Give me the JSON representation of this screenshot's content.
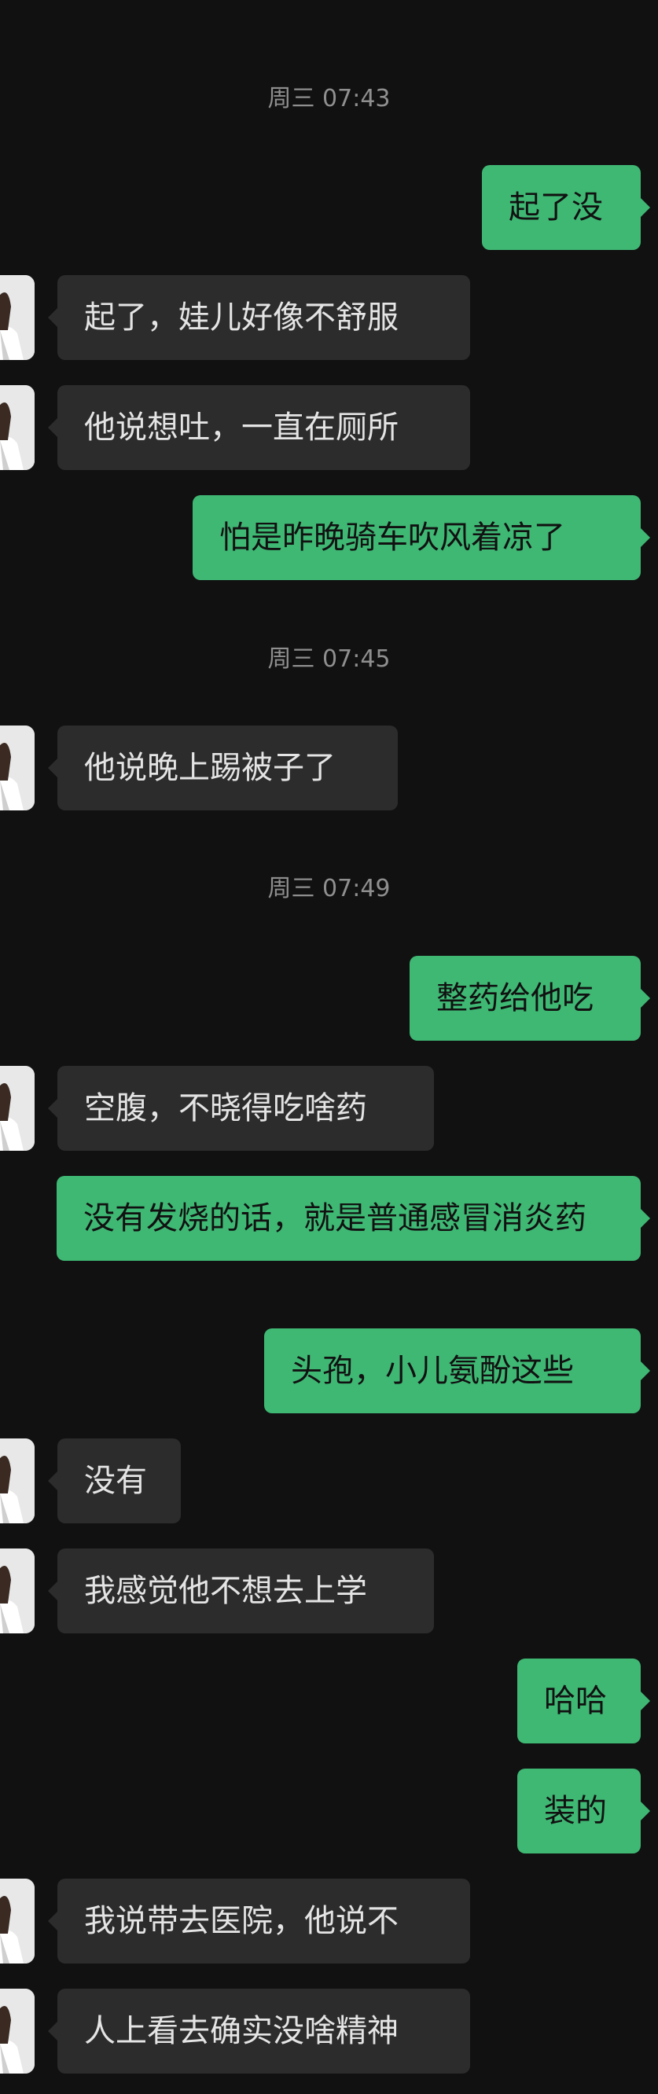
{
  "colors": {
    "background": "#111111",
    "sent_bubble": "#3fb874",
    "received_bubble": "#2c2c2c",
    "timestamp": "#8f8f8f"
  },
  "timestamps": [
    "周三 07:43",
    "周三 07:45",
    "周三 07:49"
  ],
  "messages": [
    {
      "side": "sent",
      "text": "起了没"
    },
    {
      "side": "received",
      "text": "起了，娃儿好像不舒服"
    },
    {
      "side": "received",
      "text": "他说想吐，一直在厕所"
    },
    {
      "side": "sent",
      "text": "怕是昨晚骑车吹风着凉了"
    },
    {
      "side": "received",
      "text": "他说晚上踢被子了"
    },
    {
      "side": "sent",
      "text": "整药给他吃"
    },
    {
      "side": "received",
      "text": "空腹，不晓得吃啥药"
    },
    {
      "side": "sent",
      "text": "没有发烧的话，就是普通感冒消炎药"
    },
    {
      "side": "sent",
      "text": "头孢，小儿氨酚这些"
    },
    {
      "side": "received",
      "text": "没有"
    },
    {
      "side": "received",
      "text": "我感觉他不想去上学"
    },
    {
      "side": "sent",
      "text": "哈哈"
    },
    {
      "side": "sent",
      "text": "装的"
    },
    {
      "side": "received",
      "text": "我说带去医院，他说不"
    },
    {
      "side": "received",
      "text": "人上看去确实没啥精神"
    }
  ]
}
